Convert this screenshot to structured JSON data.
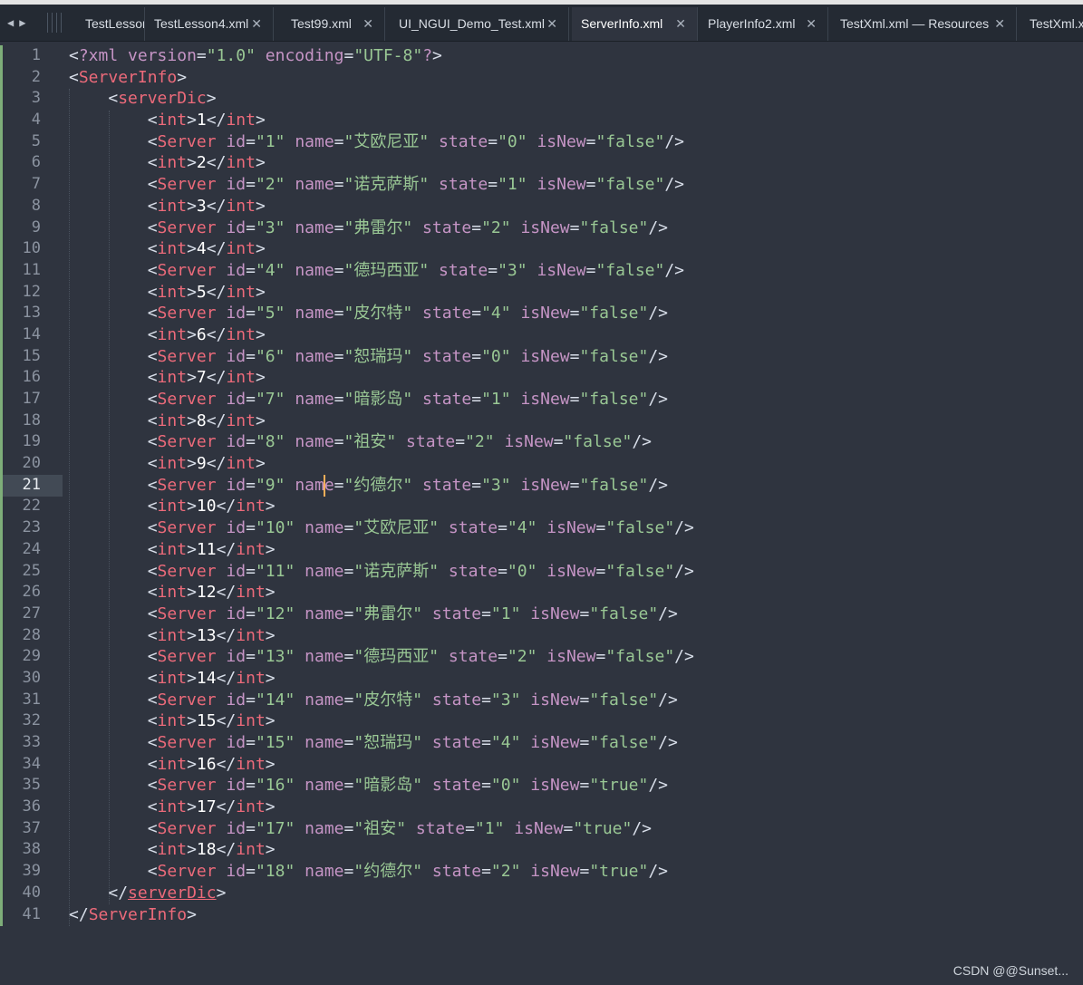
{
  "tabs": [
    {
      "label": "TestLessor",
      "closable": false,
      "active": false
    },
    {
      "label": "TestLesson4.xml",
      "closable": true,
      "active": false
    },
    {
      "label": "Test99.xml",
      "closable": true,
      "active": false
    },
    {
      "label": "UI_NGUI_Demo_Test.xml",
      "closable": true,
      "active": false
    },
    {
      "label": "ServerInfo.xml",
      "closable": true,
      "active": true
    },
    {
      "label": "PlayerInfo2.xml",
      "closable": true,
      "active": false
    },
    {
      "label": "TestXml.xml — Resources",
      "closable": true,
      "active": false
    },
    {
      "label": "TestXml.x",
      "closable": false,
      "active": false
    }
  ],
  "nav": {
    "prev": "◀",
    "next": "▶"
  },
  "close_glyph": "✕",
  "current_line": 21,
  "xml": {
    "declaration": {
      "version": "1.0",
      "encoding": "UTF-8"
    },
    "root": "ServerInfo",
    "container": "serverDic",
    "key_tag": "int",
    "item_tag": "Server",
    "servers": [
      {
        "key": "1",
        "id": "1",
        "name": "艾欧尼亚",
        "state": "0",
        "isNew": "false"
      },
      {
        "key": "2",
        "id": "2",
        "name": "诺克萨斯",
        "state": "1",
        "isNew": "false"
      },
      {
        "key": "3",
        "id": "3",
        "name": "弗雷尔",
        "state": "2",
        "isNew": "false"
      },
      {
        "key": "4",
        "id": "4",
        "name": "德玛西亚",
        "state": "3",
        "isNew": "false"
      },
      {
        "key": "5",
        "id": "5",
        "name": "皮尔特",
        "state": "4",
        "isNew": "false"
      },
      {
        "key": "6",
        "id": "6",
        "name": "恕瑞玛",
        "state": "0",
        "isNew": "false"
      },
      {
        "key": "7",
        "id": "7",
        "name": "暗影岛",
        "state": "1",
        "isNew": "false"
      },
      {
        "key": "8",
        "id": "8",
        "name": "祖安",
        "state": "2",
        "isNew": "false"
      },
      {
        "key": "9",
        "id": "9",
        "name": "约德尔",
        "state": "3",
        "isNew": "false"
      },
      {
        "key": "10",
        "id": "10",
        "name": "艾欧尼亚",
        "state": "4",
        "isNew": "false"
      },
      {
        "key": "11",
        "id": "11",
        "name": "诺克萨斯",
        "state": "0",
        "isNew": "false"
      },
      {
        "key": "12",
        "id": "12",
        "name": "弗雷尔",
        "state": "1",
        "isNew": "false"
      },
      {
        "key": "13",
        "id": "13",
        "name": "德玛西亚",
        "state": "2",
        "isNew": "false"
      },
      {
        "key": "14",
        "id": "14",
        "name": "皮尔特",
        "state": "3",
        "isNew": "false"
      },
      {
        "key": "15",
        "id": "15",
        "name": "恕瑞玛",
        "state": "4",
        "isNew": "false"
      },
      {
        "key": "16",
        "id": "16",
        "name": "暗影岛",
        "state": "0",
        "isNew": "true"
      },
      {
        "key": "17",
        "id": "17",
        "name": "祖安",
        "state": "1",
        "isNew": "true"
      },
      {
        "key": "18",
        "id": "18",
        "name": "约德尔",
        "state": "2",
        "isNew": "true"
      }
    ]
  },
  "watermark": "CSDN @@Sunset...",
  "colors": {
    "background": "#2f343f",
    "tag": "#ec6a7a",
    "attr": "#c594c5",
    "string": "#99c794",
    "caret": "#f9ae58",
    "gutter_bar": "#7eae79"
  }
}
